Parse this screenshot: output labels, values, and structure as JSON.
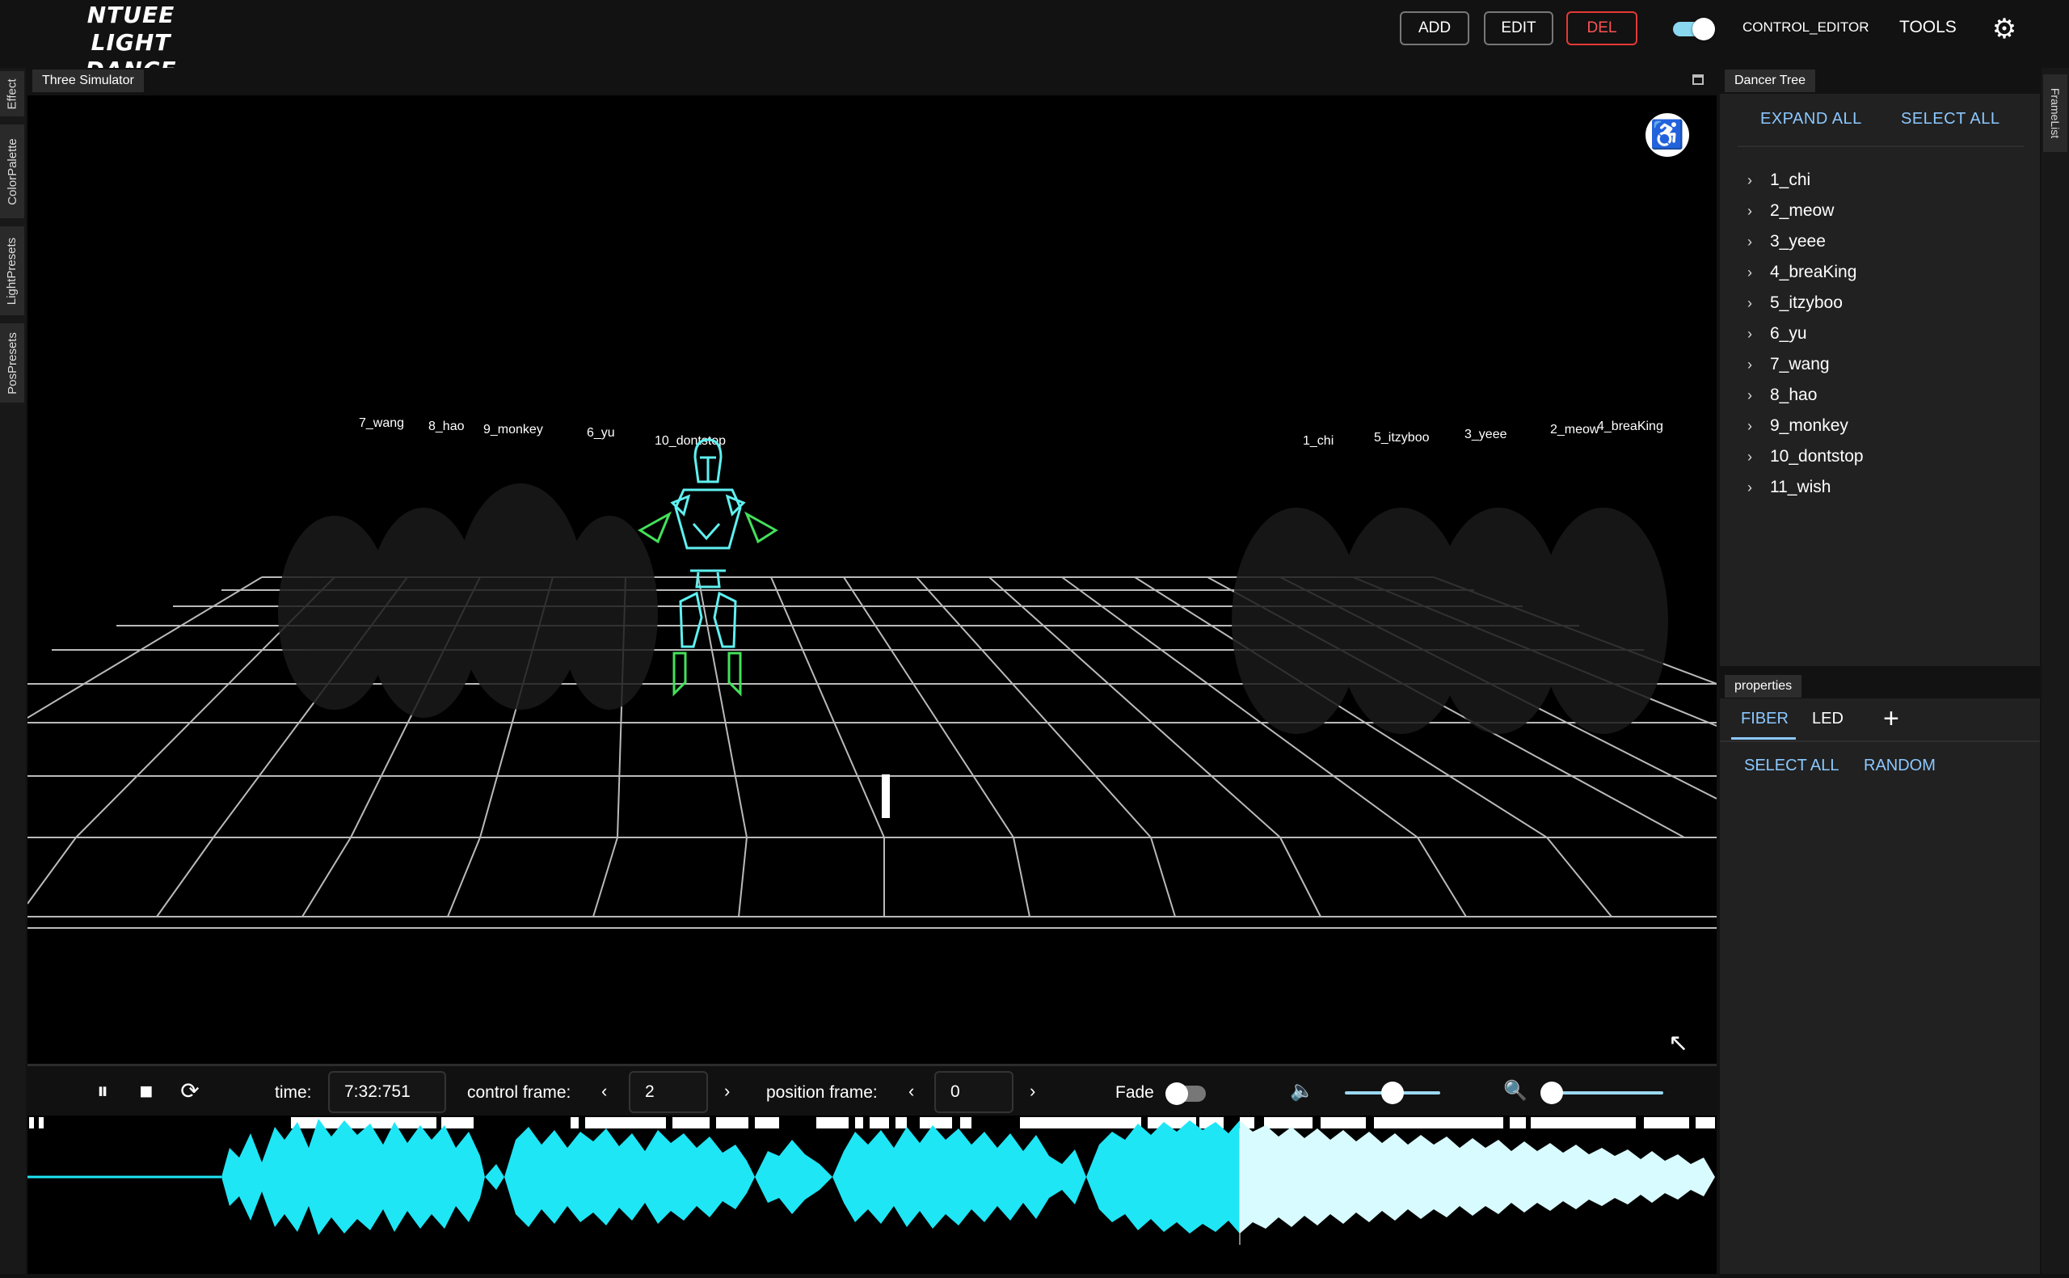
{
  "app": {
    "logo_line1": "NTUEE",
    "logo_line2": "LIGHT DANCE"
  },
  "header": {
    "add_label": "ADD",
    "edit_label": "EDIT",
    "del_label": "DEL",
    "mode_toggle_on": true,
    "mode_label": "CONTROL_EDITOR",
    "tools_label": "TOOLS",
    "settings_icon": "gear-icon"
  },
  "left_rail": {
    "tabs": [
      "Effect",
      "ColorPalette",
      "LightPresets",
      "PosPresets"
    ]
  },
  "right_rail": {
    "tabs": [
      "FrameList"
    ]
  },
  "simulator": {
    "tab_label": "Three Simulator",
    "dancer_labels": [
      "7_wang",
      "8_hao",
      "9_monkey",
      "6_yu",
      "10_dontstop",
      "1_chi",
      "5_itzyboo",
      "3_yeee",
      "2_meow",
      "4_breaKing"
    ],
    "accessibility_icon": "accessibility-icon"
  },
  "controls": {
    "time_label": "time:",
    "time_value": "7:32:751",
    "control_frame_label": "control frame:",
    "control_frame_value": "2",
    "position_frame_label": "position frame:",
    "position_frame_value": "0",
    "fade_label": "Fade",
    "fade_on": false,
    "volume_level": 0.5,
    "zoom_level": 0.0
  },
  "dancer_tree": {
    "tab_label": "Dancer Tree",
    "expand_all_label": "EXPAND ALL",
    "select_all_label": "SELECT ALL",
    "items": [
      "1_chi",
      "2_meow",
      "3_yeee",
      "4_breaKing",
      "5_itzyboo",
      "6_yu",
      "7_wang",
      "8_hao",
      "9_monkey",
      "10_dontstop",
      "11_wish"
    ]
  },
  "properties": {
    "tab_label": "properties",
    "tabs": [
      "FIBER",
      "LED"
    ],
    "active_tab": "FIBER",
    "select_all_label": "SELECT ALL",
    "random_label": "RANDOM"
  },
  "colors": {
    "accent": "#8cc8ff",
    "danger": "#ff5252",
    "waveform": "#1ee6f5",
    "waveform_played": "#d8fbff",
    "dancer_cyan": "#5ff0f0",
    "dancer_green": "#44e05a"
  }
}
